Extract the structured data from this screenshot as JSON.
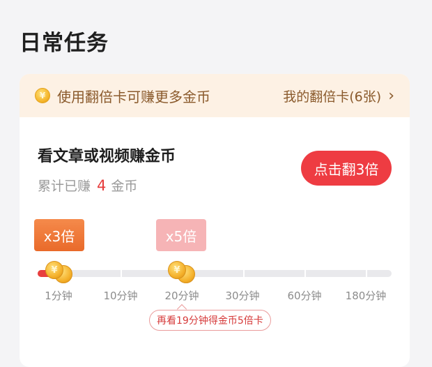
{
  "section": {
    "title": "日常任务"
  },
  "banner": {
    "coin_glyph": "¥",
    "text": "使用翻倍卡可赚更多金币",
    "my_cards_label": "我的翻倍卡(6张)",
    "chevron": "›"
  },
  "task": {
    "title": "看文章或视频赚金币",
    "earned_prefix": "累计已赚",
    "earned_amount": "4",
    "earned_suffix": "金币",
    "flip_button_label": "点击翻3倍"
  },
  "progress": {
    "badge_3x": "x3倍",
    "badge_5x": "x5倍",
    "coin_glyph": "¥",
    "ticks": [
      "1分钟",
      "10分钟",
      "20分钟",
      "30分钟",
      "60分钟",
      "180分钟"
    ],
    "hint": "再看19分钟得金币5倍卡"
  },
  "colors": {
    "accent_red": "#ee3c42",
    "banner_bg": "#fdf1e4",
    "banner_text": "#8a5a2c",
    "badge_orange": "#ec7333",
    "badge_pink": "#f6b4b6"
  }
}
